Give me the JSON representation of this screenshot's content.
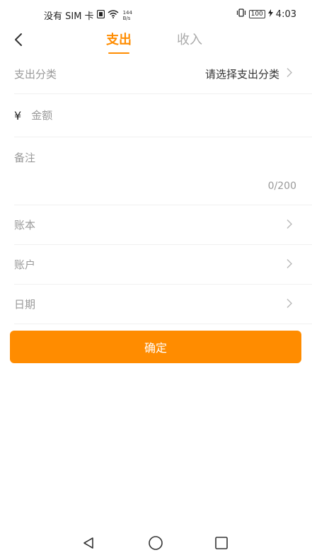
{
  "status_bar": {
    "carrier": "没有 SIM 卡",
    "net_speed_value": "144",
    "net_speed_unit": "B/s",
    "battery": "100",
    "time": "4:03"
  },
  "tabs": {
    "expense": "支出",
    "income": "收入",
    "active": "expense"
  },
  "form": {
    "category": {
      "label": "支出分类",
      "value": "请选择支出分类"
    },
    "amount": {
      "currency": "¥",
      "placeholder": "金额",
      "value": ""
    },
    "note": {
      "placeholder": "备注",
      "count": "0/200"
    },
    "ledger": {
      "label": "账本"
    },
    "account": {
      "label": "账户"
    },
    "date": {
      "label": "日期"
    }
  },
  "confirm_label": "确定",
  "icons": {
    "back": "chevron-left-icon",
    "chevron": "chevron-right-icon",
    "sys_back": "triangle-back-icon",
    "sys_home": "circle-home-icon",
    "sys_recents": "square-recents-icon"
  },
  "colors": {
    "accent": "#ff8c00",
    "muted": "#999999",
    "inactive_tab": "#aaaaaa",
    "divider": "#f0f0f0"
  }
}
